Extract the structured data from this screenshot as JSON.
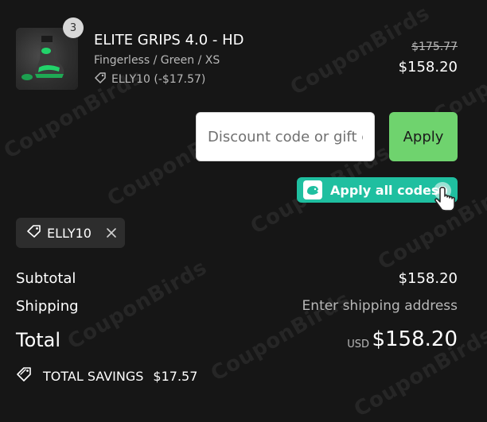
{
  "watermark": {
    "text": "CouponBirds"
  },
  "line_item": {
    "quantity": "3",
    "title": "ELITE GRIPS 4.0 - HD",
    "variant": "Fingerless / Green / XS",
    "discount_note": "ELLY10 (-$17.57)",
    "original_price": "$175.77",
    "final_price": "$158.20"
  },
  "discount_form": {
    "placeholder": "Discount code or gift card",
    "apply_label": "Apply"
  },
  "apply_all": {
    "label": "Apply all codes"
  },
  "applied_code": {
    "code": "ELLY10"
  },
  "summary": {
    "subtotal_label": "Subtotal",
    "subtotal_value": "$158.20",
    "shipping_label": "Shipping",
    "shipping_value": "Enter shipping address",
    "total_label": "Total",
    "currency": "USD",
    "total_value": "$158.20",
    "savings_label": "TOTAL SAVINGS",
    "savings_value": "$17.57"
  },
  "colors": {
    "background": "#161616",
    "apply_button": "#6fd36e",
    "apply_all_button": "#1fbfa0",
    "chip": "#2d2d2d"
  },
  "icons": {
    "tag": "tag-icon",
    "close": "close-icon",
    "savings": "savings-tag-icon",
    "logo": "couponbirds-logo-icon",
    "cursor": "hand-cursor-icon"
  }
}
